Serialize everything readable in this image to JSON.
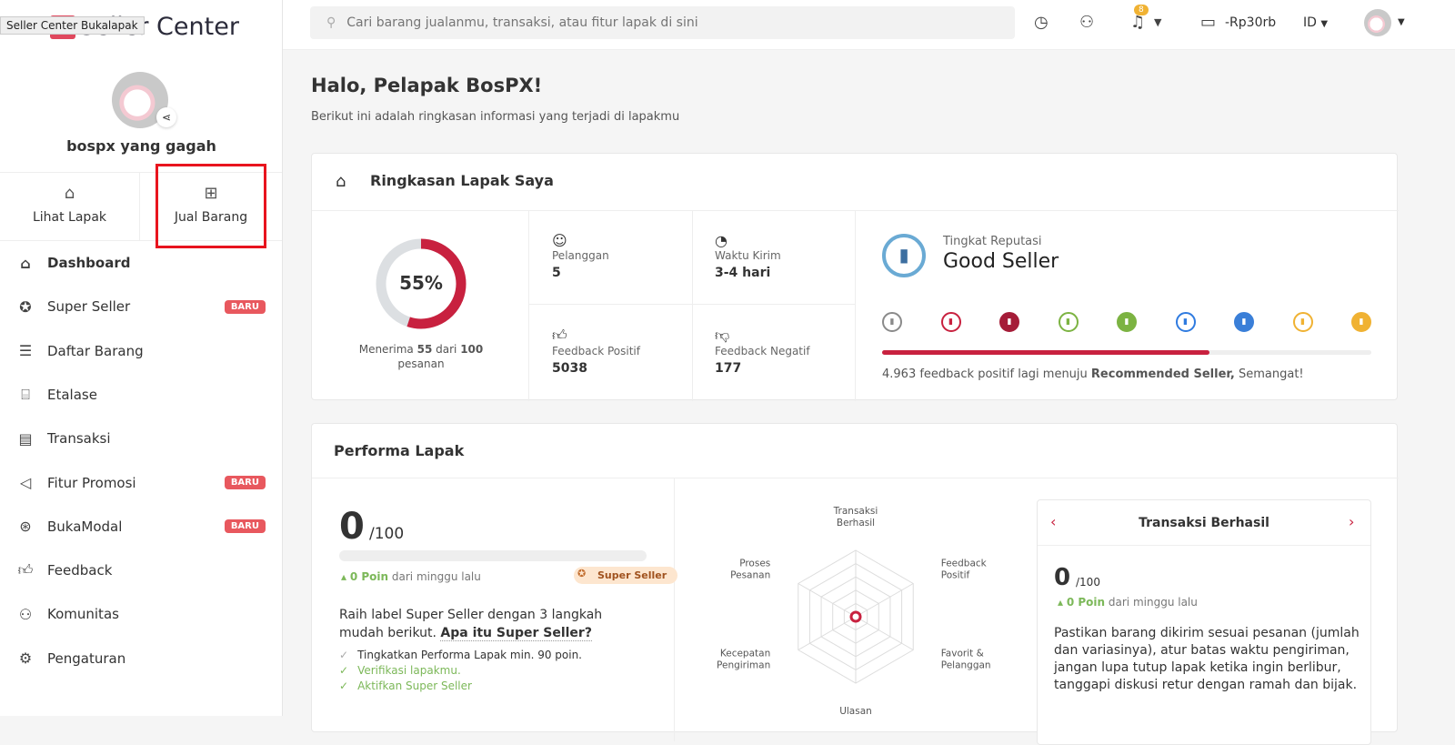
{
  "app": {
    "logo": "Seller Center",
    "tooltip": "Seller Center Bukalapak"
  },
  "profile": {
    "name": "bospx yang gagah"
  },
  "quick_actions": [
    {
      "label": "Lihat Lapak",
      "icon": "store-icon"
    },
    {
      "label": "Jual Barang",
      "icon": "add-product-icon"
    }
  ],
  "nav": [
    {
      "label": "Dashboard",
      "icon": "home-icon",
      "active": true
    },
    {
      "label": "Super Seller",
      "icon": "star-badge-icon",
      "badge": "BARU"
    },
    {
      "label": "Daftar Barang",
      "icon": "list-icon"
    },
    {
      "label": "Etalase",
      "icon": "tag-icon"
    },
    {
      "label": "Transaksi",
      "icon": "receipt-icon"
    },
    {
      "label": "Fitur Promosi",
      "icon": "megaphone-icon",
      "badge": "BARU"
    },
    {
      "label": "BukaModal",
      "icon": "money-icon",
      "badge": "BARU"
    },
    {
      "label": "Feedback",
      "icon": "thumb-up-icon"
    },
    {
      "label": "Komunitas",
      "icon": "community-icon"
    },
    {
      "label": "Pengaturan",
      "icon": "gear-icon"
    }
  ],
  "header": {
    "search_placeholder": "Cari barang jualanmu, transaksi, atau fitur lapak di sini",
    "notif_count": "8",
    "balance": "-Rp30rb",
    "lang": "ID"
  },
  "greeting": {
    "title": "Halo, Pelapak BosPX!",
    "subtitle": "Berikut ini adalah ringkasan informasi yang terjadi di lapakmu"
  },
  "summary": {
    "title": "Ringkasan Lapak Saya",
    "percent": 55,
    "percent_label": "55%",
    "accept_pre": "Menerima",
    "accepted": "55",
    "accept_mid": "dari",
    "total": "100",
    "accept_post": "pesanan",
    "stats": [
      {
        "label": "Pelanggan",
        "value": "5"
      },
      {
        "label": "Waktu Kirim",
        "value": "3-4 hari"
      },
      {
        "label": "Feedback Positif",
        "value": "5038"
      },
      {
        "label": "Feedback Negatif",
        "value": "177"
      }
    ],
    "reputation": {
      "label": "Tingkat Reputasi",
      "level": "Good Seller",
      "progress": 0.67,
      "note_pre": "4.963 feedback positif lagi menuju",
      "note_bold": "Recommended Seller,",
      "note_post": "Semangat!",
      "badge_colors": [
        "#8a8a8a",
        "#c8213f",
        "#a51c38",
        "#7cb342",
        "#7cb342",
        "#2f7be0",
        "#3a7fd8",
        "#f0b233",
        "#f0b233"
      ]
    }
  },
  "performance": {
    "title": "Performa Lapak",
    "score": "0",
    "max": "/100",
    "progress": 0,
    "delta": "0 Poin",
    "delta_label": "dari minggu lalu",
    "super_badge": "Super Seller",
    "desc": "Raih label Super Seller dengan 3 langkah mudah berikut.",
    "link": "Apa itu Super Seller?",
    "steps": [
      {
        "text": "Tingkatkan Performa Lapak min. 90 poin.",
        "done": false
      },
      {
        "text": "Verifikasi lapakmu.",
        "done": true
      },
      {
        "text": "Aktifkan Super Seller",
        "done": true
      }
    ],
    "radar_labels": [
      "Transaksi Berhasil",
      "Feedback Positif",
      "Favorit & Pelanggan",
      "Ulasan",
      "Kecepatan Pengiriman",
      "Proses Pesanan"
    ],
    "detail": {
      "title": "Transaksi Berhasil",
      "score": "0",
      "max": "/100",
      "delta": "0 Poin",
      "delta_label": "dari minggu lalu",
      "text": "Pastikan barang dikirim sesuai pesanan (jumlah dan variasinya), atur batas waktu pengiriman, jangan lupa tutup lapak ketika ingin berlibur, tanggapi diskusi retur dengan ramah dan bijak."
    }
  }
}
